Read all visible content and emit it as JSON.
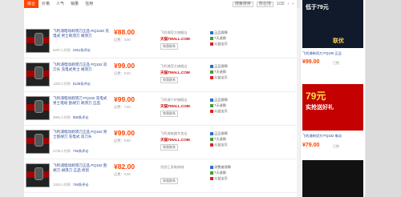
{
  "tabs": [
    "综合",
    "价格",
    "人气",
    "销量",
    "信用"
  ],
  "toolbar": {
    "sort": "搜索排序",
    "location": "所在地",
    "page": "1/32"
  },
  "rows": [
    {
      "title": "飞利浦电动剃须刀正品 RQ1160 充电式 男士剃须刀 胡须刀",
      "price": "¥88.00",
      "ship": "运费：0.00",
      "sold": "5297人付款",
      "reviews": "2451条评论",
      "shop": "飞利浦官方旗舰店",
      "tmall": "天猫TMALL.COM",
      "ww": "和我联系",
      "tags": [
        "正品保障",
        "7天退换",
        "公益宝贝"
      ]
    },
    {
      "title": "飞利浦电动剃须刀正品 PQ182 双刀头 充电式男士 胡须刀",
      "price": "¥99.00",
      "ship": "运费：0.00",
      "sold": "1320人付款",
      "reviews": "5135条评论",
      "shop": "飞利浦官方旗舰店",
      "tmall": "天猫TMALL.COM",
      "ww": "和我联系",
      "tags": [
        "正品保障",
        "7天退换",
        "公益宝贝"
      ]
    },
    {
      "title": "飞利浦电动剃须刀 PQ182 充电式男士电动 刮胡刀 剃须刀 正品",
      "price": "¥99.00",
      "ship": "运费：7.00",
      "sold": "3961人付款",
      "reviews": "558条评论",
      "shop": "飞利浦个护旗舰店",
      "tmall": "天猫TMALL.COM",
      "ww": "和我联系",
      "tags": [
        "正品保障",
        "7天退换",
        "公益宝贝"
      ]
    },
    {
      "title": "飞利浦电动剃须刀正品 PQ182 男士刮胡刀 充电式 双刀头",
      "price": "¥99.00",
      "ship": "运费：0.00",
      "sold": "2729人付款",
      "reviews": "745条评论",
      "shop": "飞利浦电器专卖店",
      "tmall": "天猫TMALL.COM",
      "ww": "和我联系",
      "tags": [
        "正品保障",
        "7天退换",
        "公益宝贝"
      ]
    },
    {
      "title": "飞利浦电动剃须刀正品 PQ192 刮胡刀 胡须刀 正品 修剪",
      "price": "¥82.00",
      "ship": "运费：0.00",
      "sold": "1324人付款",
      "reviews": "748条评论",
      "shop": "杰民汇家电商城",
      "tmall": "",
      "ww": "和我联系",
      "tags": [
        "消费者保障",
        "7天退换",
        "公益宝贝"
      ]
    }
  ],
  "side": {
    "ad1_text": "低于79元",
    "ad1_brand": "联优",
    "cap1": "飞利浦剃须刀 PQ190 正品",
    "price1": "¥99.00",
    "sold1": "已售",
    "ad2_text": "79元",
    "ad2_sub": "实抢送好礼",
    "cap2": "飞利浦剃须刀 PQ182 电动",
    "price2": "¥79.00",
    "sold2": "已售"
  },
  "colors": {
    "accent": "#ff4400",
    "link": "#2a4a9a",
    "price": "#ff4400"
  }
}
